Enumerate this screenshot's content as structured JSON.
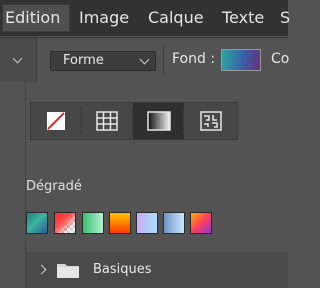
{
  "menu": {
    "items": [
      {
        "label": "Edition",
        "active": true
      },
      {
        "label": "Image",
        "active": false
      },
      {
        "label": "Calque",
        "active": false
      },
      {
        "label": "Texte",
        "active": false
      },
      {
        "label": "S",
        "active": false
      }
    ]
  },
  "options": {
    "mode_select": {
      "value": "Forme"
    },
    "fill_label": "Fond :",
    "stroke_label_partial": "Co",
    "fill_swatch_colors": [
      "#2aa9a0",
      "#3b5fa8",
      "#6a2f7a"
    ]
  },
  "panel": {
    "fill_type_buttons": [
      {
        "icon": "no-fill-icon",
        "selected": false
      },
      {
        "icon": "solid-color-grid-icon",
        "selected": false
      },
      {
        "icon": "gradient-icon",
        "selected": true
      },
      {
        "icon": "pattern-icon",
        "selected": false
      }
    ],
    "section_title": "Dégradé",
    "gradients": [
      {
        "colors": [
          "#1f7f7a",
          "#3cb4a0",
          "#2a5f9a"
        ]
      },
      {
        "colors": [
          "#ff2a2a",
          "#ff5a5a",
          "transparent"
        ]
      },
      {
        "colors": [
          "#37c46f",
          "#7ad9a6",
          "#b7efcf"
        ]
      },
      {
        "colors": [
          "#ffb000",
          "#ff7a00",
          "#ff3d00"
        ]
      },
      {
        "colors": [
          "#c9a8f6",
          "#b8c8fb",
          "#a9ddff"
        ]
      },
      {
        "colors": [
          "#6e93c4",
          "#9dc0e6",
          "#c9e4f7"
        ]
      },
      {
        "colors": [
          "#ffb000",
          "#ff3d5a",
          "#8a3ad6"
        ]
      }
    ],
    "folder": {
      "label": "Basiques",
      "expanded": false
    }
  },
  "colors": {
    "menubar_bg": "#323232",
    "panel_bg": "#535353",
    "selected_button_bg": "#2f2f2f"
  }
}
